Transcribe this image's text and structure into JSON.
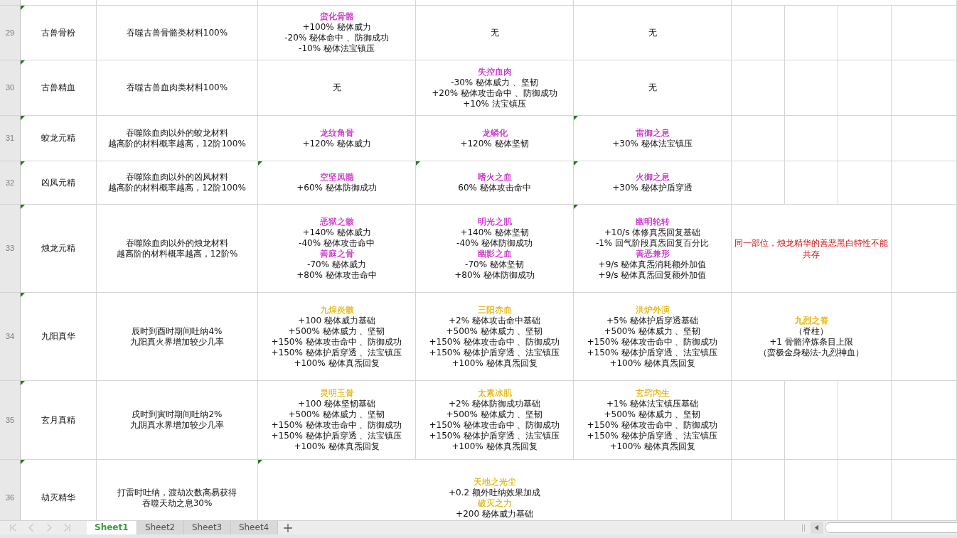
{
  "rows": [
    {
      "number": "29",
      "cells": [
        {
          "kind": "text",
          "flagged": true,
          "merged": false,
          "lines": [
            "古兽骨粉"
          ]
        },
        {
          "kind": "text",
          "flagged": false,
          "merged": false,
          "lines": [
            "吞噬古兽骨骼类材料100%"
          ]
        },
        {
          "kind": "effects",
          "flagged": false,
          "merged": false,
          "effects": [
            {
              "name": "蛮化骨骼",
              "color": "#cc33cc",
              "lines": [
                "+100% 秘体威力",
                "-20% 秘体命中 、防御成功",
                "-10% 秘体法宝镇压"
              ]
            }
          ]
        },
        {
          "kind": "text",
          "flagged": false,
          "merged": false,
          "lines": [
            "无"
          ]
        },
        {
          "kind": "text",
          "flagged": false,
          "merged": false,
          "lines": [
            "无"
          ]
        }
      ]
    },
    {
      "number": "30",
      "cells": [
        {
          "kind": "text",
          "flagged": true,
          "merged": false,
          "lines": [
            "古兽精血"
          ]
        },
        {
          "kind": "text",
          "flagged": false,
          "merged": false,
          "lines": [
            "吞噬古兽血肉类材料100%"
          ]
        },
        {
          "kind": "text",
          "flagged": false,
          "merged": false,
          "lines": [
            "无"
          ]
        },
        {
          "kind": "effects",
          "flagged": false,
          "merged": false,
          "effects": [
            {
              "name": "失控血肉",
              "color": "#cc33cc",
              "lines": [
                "-30% 秘体威力 、坚韧",
                "+20% 秘体攻击命中 、防御成功",
                "+10% 法宝镇压"
              ]
            }
          ]
        },
        {
          "kind": "text",
          "flagged": false,
          "merged": false,
          "lines": [
            "无"
          ]
        }
      ]
    },
    {
      "number": "31",
      "cells": [
        {
          "kind": "text",
          "flagged": true,
          "merged": false,
          "lines": [
            "蛟龙元精"
          ]
        },
        {
          "kind": "text",
          "flagged": false,
          "merged": false,
          "lines": [
            "吞噬除血肉以外的蛟龙材料",
            "越高阶的材料概率越高，12阶100%"
          ]
        },
        {
          "kind": "effects",
          "flagged": false,
          "merged": false,
          "effects": [
            {
              "name": "龙纹角骨",
              "color": "#cc33cc",
              "lines": [
                "+120% 秘体威力"
              ]
            }
          ]
        },
        {
          "kind": "effects",
          "flagged": false,
          "merged": false,
          "effects": [
            {
              "name": "龙鳞化",
              "color": "#cc33cc",
              "lines": [
                "+120% 秘体坚韧"
              ]
            }
          ]
        },
        {
          "kind": "effects",
          "flagged": true,
          "merged": false,
          "effects": [
            {
              "name": "雷御之息",
              "color": "#cc33cc",
              "lines": [
                "+30% 秘体法宝镇压"
              ]
            }
          ]
        }
      ]
    },
    {
      "number": "32",
      "cells": [
        {
          "kind": "text",
          "flagged": true,
          "merged": false,
          "lines": [
            "凶凤元精"
          ]
        },
        {
          "kind": "text",
          "flagged": false,
          "merged": false,
          "lines": [
            "吞噬除血肉以外的凶凤材料",
            "越高阶的材料概率越高，12阶100%"
          ]
        },
        {
          "kind": "effects",
          "flagged": true,
          "merged": false,
          "effects": [
            {
              "name": "空坚凤髓",
              "color": "#cc33cc",
              "lines": [
                "+60% 秘体防御成功"
              ]
            }
          ]
        },
        {
          "kind": "effects",
          "flagged": true,
          "merged": false,
          "effects": [
            {
              "name": "嗜火之血",
              "color": "#cc33cc",
              "lines": [
                "60% 秘体攻击命中"
              ]
            }
          ]
        },
        {
          "kind": "effects",
          "flagged": true,
          "merged": false,
          "effects": [
            {
              "name": "火御之息",
              "color": "#cc33cc",
              "lines": [
                "+30% 秘体护盾穿透"
              ]
            }
          ]
        }
      ]
    },
    {
      "number": "33",
      "cells": [
        {
          "kind": "text",
          "flagged": true,
          "merged": false,
          "lines": [
            "烛龙元精"
          ]
        },
        {
          "kind": "text",
          "flagged": false,
          "merged": false,
          "lines": [
            "吞噬除血肉以外的烛龙材料",
            "越高阶的材料概率越高，12阶%"
          ]
        },
        {
          "kind": "effects",
          "flagged": false,
          "merged": false,
          "effects": [
            {
              "name": "恶狱之骸",
              "color": "#cc33cc",
              "lines": [
                "+140% 秘体威力",
                "-40% 秘体攻击命中"
              ]
            },
            {
              "name": "善庭之骨",
              "color": "#cc33cc",
              "lines": [
                "-70% 秘体威力",
                "+80% 秘体攻击命中"
              ]
            }
          ]
        },
        {
          "kind": "effects",
          "flagged": false,
          "merged": false,
          "effects": [
            {
              "name": "明光之肌",
              "color": "#cc33cc",
              "lines": [
                "+140% 秘体坚韧",
                "-40% 秘体防御成功"
              ]
            },
            {
              "name": "幽影之血",
              "color": "#cc33cc",
              "lines": [
                "-70% 秘体坚韧",
                "+80% 秘体防御成功"
              ]
            }
          ]
        },
        {
          "kind": "effects",
          "flagged": true,
          "merged": false,
          "effects": [
            {
              "name": "幽明轮转",
              "color": "#cc33cc",
              "lines": [
                "+10/s 体修真炁回复基础",
                "-1% 回气阶段真炁回复百分比"
              ]
            },
            {
              "name": "善恶兼形",
              "color": "#cc33cc",
              "lines": [
                "+9/s 秘体真炁消耗额外加值",
                "+9/s 秘体真炁回复额外加值"
              ]
            }
          ]
        },
        {
          "kind": "note",
          "flagged": false,
          "merged": true,
          "text": "同一部位，烛龙精华的善恶黑白特性不能共存"
        }
      ]
    },
    {
      "number": "34",
      "cells": [
        {
          "kind": "text",
          "flagged": true,
          "merged": false,
          "lines": [
            "九阳真华"
          ]
        },
        {
          "kind": "text",
          "flagged": false,
          "merged": false,
          "lines": [
            "辰时到酉时期间吐纳4%",
            "九阳真火界增加较少几率"
          ]
        },
        {
          "kind": "effects",
          "flagged": false,
          "merged": false,
          "effects": [
            {
              "name": "九煌炎骸",
              "color": "#e8b812",
              "lines": [
                "+100 秘体威力基础",
                "+500% 秘体威力 、坚韧",
                "+150% 秘体攻击命中 、防御成功",
                "+150% 秘体护盾穿透 、法宝镇压",
                "+100% 秘体真炁回复"
              ]
            }
          ]
        },
        {
          "kind": "effects",
          "flagged": false,
          "merged": false,
          "effects": [
            {
              "name": "三阳赤血",
              "color": "#e8b812",
              "lines": [
                "+2% 秘体攻击命中基础",
                "+500% 秘体威力 、坚韧",
                "+150% 秘体攻击命中 、防御成功",
                "+150% 秘体护盾穿透 、法宝镇压",
                "+100% 秘体真炁回复"
              ]
            }
          ]
        },
        {
          "kind": "effects",
          "flagged": false,
          "merged": false,
          "effects": [
            {
              "name": "洪炉外演",
              "color": "#e8b812",
              "lines": [
                "+5% 秘体护盾穿透基础",
                "+500% 秘体威力 、坚韧",
                "+150% 秘体攻击命中 、防御成功",
                "+150% 秘体护盾穿透 、法宝镇压",
                "+100% 秘体真炁回复"
              ]
            }
          ]
        },
        {
          "kind": "effects",
          "flagged": false,
          "merged": true,
          "effects": [
            {
              "name": "九烈之脊",
              "color": "#e8b812",
              "lines": [
                "（脊柱）",
                "+1 骨骼淬炼条目上限",
                "（蛮极金身秘法-九烈神血）"
              ]
            }
          ]
        }
      ]
    },
    {
      "number": "35",
      "cells": [
        {
          "kind": "text",
          "flagged": true,
          "merged": false,
          "lines": [
            "玄月真精"
          ]
        },
        {
          "kind": "text",
          "flagged": false,
          "merged": false,
          "lines": [
            "戌时到寅时期间吐纳2%",
            "九阴真水界增加较少几率"
          ]
        },
        {
          "kind": "effects",
          "flagged": false,
          "merged": false,
          "effects": [
            {
              "name": "灵明玉骨",
              "color": "#e8b812",
              "lines": [
                "+100 秘体坚韧基础",
                "+500% 秘体威力 、坚韧",
                "+150% 秘体攻击命中 、防御成功",
                "+150% 秘体护盾穿透 、法宝镇压",
                "+100% 秘体真炁回复"
              ]
            }
          ]
        },
        {
          "kind": "effects",
          "flagged": false,
          "merged": false,
          "effects": [
            {
              "name": "太素冰肌",
              "color": "#e8b812",
              "lines": [
                "+2% 秘体防御成功基础",
                "+500% 秘体威力 、坚韧",
                "+150% 秘体攻击命中 、防御成功",
                "+150% 秘体护盾穿透 、法宝镇压",
                "+100% 秘体真炁回复"
              ]
            }
          ]
        },
        {
          "kind": "effects",
          "flagged": false,
          "merged": false,
          "effects": [
            {
              "name": "玄窍内生",
              "color": "#e8b812",
              "lines": [
                "+1% 秘体法宝镇压基础",
                "+500% 秘体威力 、坚韧",
                "+150% 秘体攻击命中 、防御成功",
                "+150% 秘体护盾穿透 、法宝镇压",
                "+100% 秘体真炁回复"
              ]
            }
          ]
        }
      ]
    },
    {
      "number": "36",
      "cells": [
        {
          "kind": "text",
          "flagged": true,
          "merged": false,
          "lines": [
            "劫灭精华"
          ]
        },
        {
          "kind": "text",
          "flagged": false,
          "merged": false,
          "lines": [
            "打雷时吐纳，渡劫次数高易获得",
            "吞噬天劫之息30%"
          ]
        },
        {
          "kind": "effects",
          "flagged": true,
          "merged": true,
          "effects": [
            {
              "name": "天地之光尘",
              "color": "#e8b812",
              "lines": [
                "+0.2 额外吐纳效果加成"
              ]
            },
            {
              "name": "破灭之力",
              "color": "#e8b812",
              "lines": [
                "+200 秘体威力基础"
              ]
            }
          ]
        }
      ]
    }
  ],
  "sheet_navigation": {
    "disabled": true
  },
  "sheet_tabs": [
    {
      "label": "Sheet1",
      "selected": true
    },
    {
      "label": "Sheet2",
      "selected": false
    },
    {
      "label": "Sheet3",
      "selected": false
    },
    {
      "label": "Sheet4",
      "selected": false
    }
  ]
}
